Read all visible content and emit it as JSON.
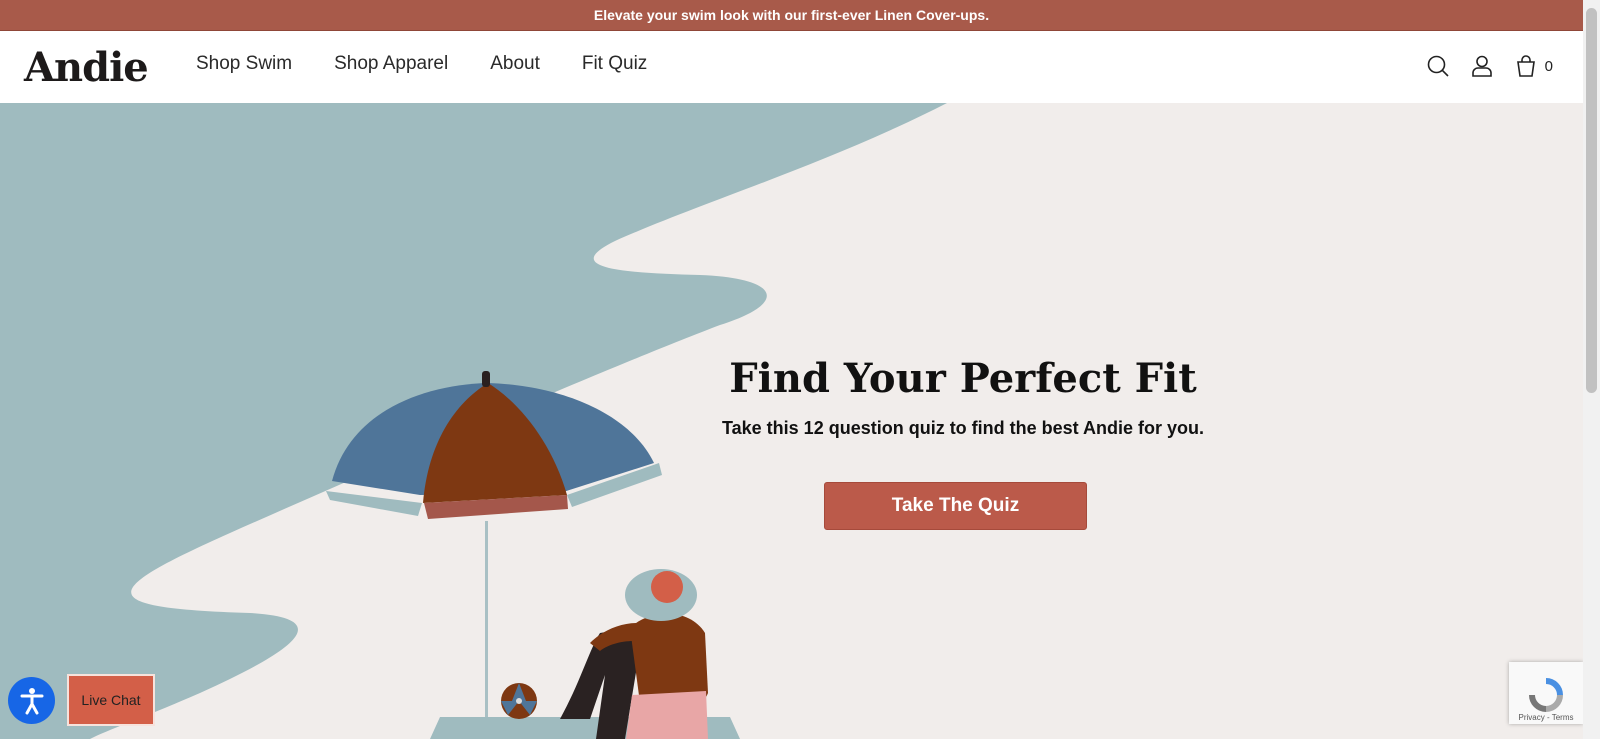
{
  "announcement": "Elevate your swim look with our first-ever Linen Cover-ups.",
  "brand": "Andie",
  "nav": [
    {
      "label": "Shop Swim"
    },
    {
      "label": "Shop Apparel"
    },
    {
      "label": "About"
    },
    {
      "label": "Fit Quiz"
    }
  ],
  "header_icons": {
    "search": "search-icon",
    "account": "user-icon",
    "cart": "bag-icon",
    "cart_count": "0"
  },
  "hero": {
    "title": "Find Your Perfect Fit",
    "subtitle": "Take this 12 question quiz to find the best Andie for you.",
    "cta": "Take The Quiz"
  },
  "widgets": {
    "live_chat": "Live Chat",
    "recaptcha": "Privacy - Terms"
  },
  "colors": {
    "announcement_bg": "#a85a4a",
    "cta_bg": "#bb5a4a",
    "hero_bg": "#f1edeb",
    "water": "#9fbbbf"
  }
}
